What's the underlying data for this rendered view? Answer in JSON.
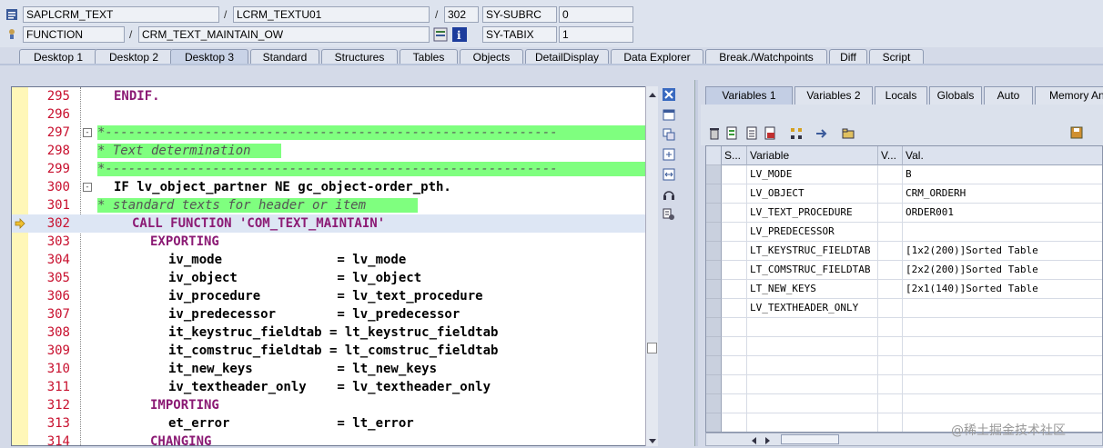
{
  "header": {
    "program": "SAPLCRM_TEXT",
    "include": "LCRM_TEXTU01",
    "line": "302",
    "sysvar1": "SY-SUBRC",
    "sysval1": "0",
    "event_type": "FUNCTION",
    "event": "CRM_TEXT_MAINTAIN_OW",
    "sysvar2": "SY-TABIX",
    "sysval2": "1",
    "sep1": "/",
    "sep2": "/",
    "sep3": "/"
  },
  "tabs": [
    "Desktop 1",
    "Desktop 2",
    "Desktop 3",
    "Standard",
    "Structures",
    "Tables",
    "Objects",
    "DetailDisplay",
    "Data Explorer",
    "Break./Watchpoints",
    "Diff",
    "Script"
  ],
  "active_tab": "Desktop 3",
  "code": [
    {
      "n": "295",
      "t": "ENDIF."
    },
    {
      "n": "296",
      "t": ""
    },
    {
      "n": "297",
      "t": "*-----------------------------------------------------------"
    },
    {
      "n": "298",
      "t": "* Text determination"
    },
    {
      "n": "299",
      "t": "*-----------------------------------------------------------"
    },
    {
      "n": "300",
      "t": "IF lv_object_partner NE gc_object-order_pth."
    },
    {
      "n": "301",
      "t": "* standard texts for header or item"
    },
    {
      "n": "302",
      "t": "CALL FUNCTION 'COM_TEXT_MAINTAIN'"
    },
    {
      "n": "303",
      "t": "EXPORTING"
    },
    {
      "n": "304",
      "t": "iv_mode               = lv_mode"
    },
    {
      "n": "305",
      "t": "iv_object             = lv_object"
    },
    {
      "n": "306",
      "t": "iv_procedure          = lv_text_procedure"
    },
    {
      "n": "307",
      "t": "iv_predecessor        = lv_predecessor"
    },
    {
      "n": "308",
      "t": "it_keystruc_fieldtab = lt_keystruc_fieldtab"
    },
    {
      "n": "309",
      "t": "it_comstruc_fieldtab = lt_comstruc_fieldtab"
    },
    {
      "n": "310",
      "t": "it_new_keys           = lt_new_keys"
    },
    {
      "n": "311",
      "t": "iv_textheader_only    = lv_textheader_only"
    },
    {
      "n": "312",
      "t": "IMPORTING"
    },
    {
      "n": "313",
      "t": "et_error              = lt_error"
    },
    {
      "n": "314",
      "t": "CHANGING"
    }
  ],
  "current_line": "302",
  "right_tabs": [
    "Variables 1",
    "Variables 2",
    "Locals",
    "Globals",
    "Auto",
    "Memory An"
  ],
  "grid": {
    "headers": [
      "S...",
      "Variable",
      "V...",
      "Val."
    ],
    "rows": [
      {
        "var": "LV_MODE",
        "val": "B"
      },
      {
        "var": "LV_OBJECT",
        "val": "CRM_ORDERH"
      },
      {
        "var": "LV_TEXT_PROCEDURE",
        "val": "ORDER001"
      },
      {
        "var": "LV_PREDECESSOR",
        "val": ""
      },
      {
        "var": "LT_KEYSTRUC_FIELDTAB",
        "val": "[1x2(200)]Sorted Table"
      },
      {
        "var": "LT_COMSTRUC_FIELDTAB",
        "val": "[2x2(200)]Sorted Table"
      },
      {
        "var": "LT_NEW_KEYS",
        "val": "[2x1(140)]Sorted Table"
      },
      {
        "var": "LV_TEXTHEADER_ONLY",
        "val": ""
      },
      {
        "var": "",
        "val": ""
      },
      {
        "var": "",
        "val": ""
      },
      {
        "var": "",
        "val": ""
      },
      {
        "var": "",
        "val": ""
      },
      {
        "var": "",
        "val": ""
      },
      {
        "var": "",
        "val": ""
      }
    ]
  },
  "watermark": "@稀土掘金技术社区"
}
